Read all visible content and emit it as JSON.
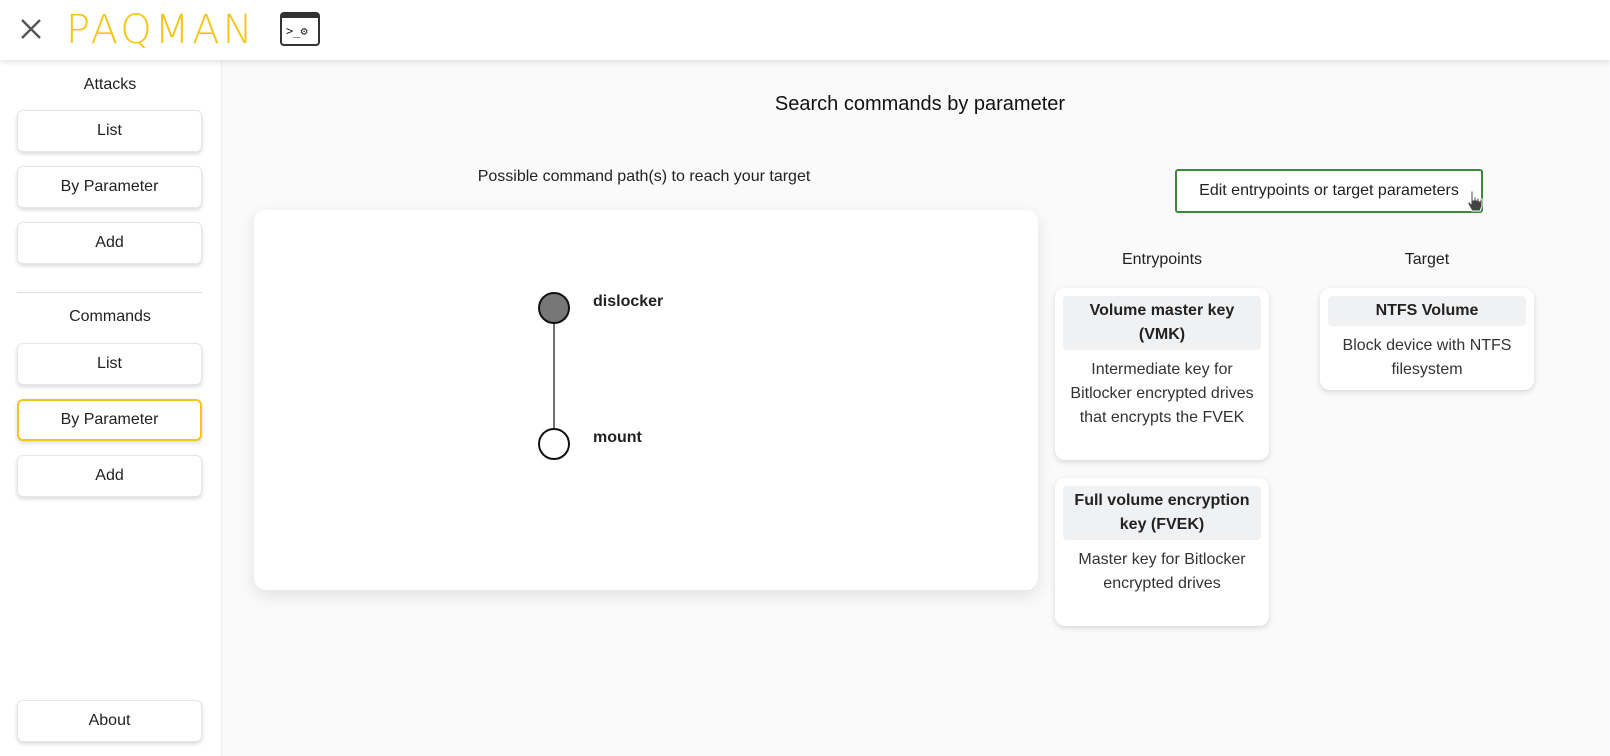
{
  "header": {
    "logo_text": "PAQMAN",
    "logo_icon_text": ">_⚙"
  },
  "sidebar": {
    "attacks_title": "Attacks",
    "attacks_items": [
      "List",
      "By Parameter",
      "Add"
    ],
    "commands_title": "Commands",
    "commands_items": [
      "List",
      "By Parameter",
      "Add"
    ],
    "active_item": "commands.By Parameter",
    "about_label": "About"
  },
  "main": {
    "title": "Search commands by parameter",
    "graph_caption": "Possible command path(s) to reach your target",
    "graph_nodes": [
      {
        "label": "dislocker",
        "filled": true
      },
      {
        "label": "mount",
        "filled": false
      }
    ],
    "edit_button": "Edit entrypoints or target parameters",
    "entrypoints_title": "Entrypoints",
    "target_title": "Target",
    "entrypoints": [
      {
        "name": "Volume master key (VMK)",
        "description": "Intermediate key for Bitlocker encrypted drives that encrypts the FVEK"
      },
      {
        "name": "Full volume encryption key (FVEK)",
        "description": "Master key for Bitlocker encrypted drives"
      }
    ],
    "target": {
      "name": "NTFS Volume",
      "description": "Block device with NTFS filesystem"
    }
  },
  "colors": {
    "accent": "#f5c518",
    "edit_border": "#3b8a3b",
    "node_filled": "#777777"
  }
}
